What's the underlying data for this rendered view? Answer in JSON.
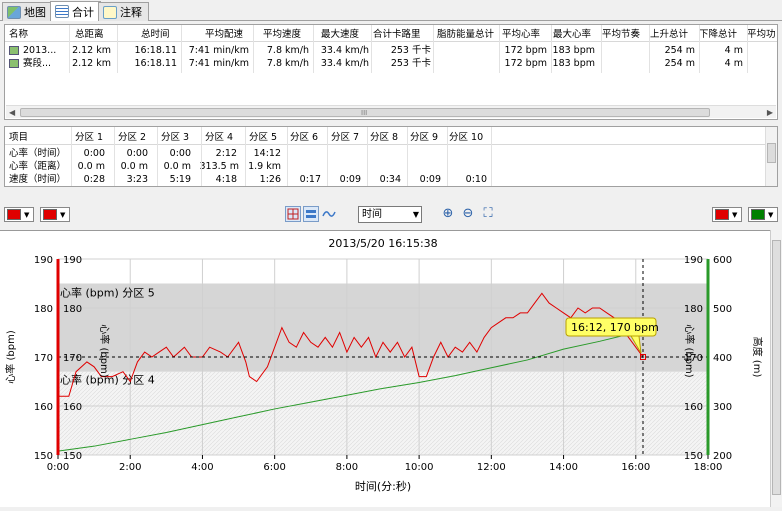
{
  "tabs": [
    {
      "label": "地图",
      "icon": "map-icon"
    },
    {
      "label": "合计",
      "icon": "summary-table-icon"
    },
    {
      "label": "注释",
      "icon": "notes-icon"
    }
  ],
  "summary_table": {
    "columns": [
      "名称",
      "总距离",
      "总时间",
      "平均配速",
      "平均速度",
      "最大速度",
      "合计卡路里",
      "脂肪能量总计",
      "平均心率",
      "最大心率",
      "平均节奏",
      "上升总计",
      "下降总计",
      "平均功"
    ],
    "rows": [
      [
        "2013...",
        "2.12 km",
        "16:18.11",
        "7:41 min/km",
        "7.8 km/h",
        "33.4 km/h",
        "253 千卡",
        "",
        "172 bpm",
        "183 bpm",
        "",
        "254 m",
        "4 m",
        ""
      ],
      [
        "赛段...",
        "2.12 km",
        "16:18.11",
        "7:41 min/km",
        "7.8 km/h",
        "33.4 km/h",
        "253 千卡",
        "",
        "172 bpm",
        "183 bpm",
        "",
        "254 m",
        "4 m",
        ""
      ]
    ],
    "scroll_grip": "III"
  },
  "zone_table": {
    "columns": [
      "项目",
      "分区 1",
      "分区 2",
      "分区 3",
      "分区 4",
      "分区 5",
      "分区 6",
      "分区 7",
      "分区 8",
      "分区 9",
      "分区 10"
    ],
    "rows": [
      [
        "心率（时间）",
        "0:00",
        "0:00",
        "0:00",
        "2:12",
        "14:12",
        "",
        "",
        "",
        "",
        ""
      ],
      [
        "心率（距离）",
        "0.0 m",
        "0.0 m",
        "0.0 m",
        "313.5 m",
        "1.9 km",
        "",
        "",
        "",
        "",
        ""
      ],
      [
        "速度（时间）",
        "0:28",
        "3:23",
        "5:19",
        "4:18",
        "1:26",
        "0:17",
        "0:09",
        "0:34",
        "0:09",
        "0:10"
      ]
    ]
  },
  "toolbar": {
    "x_axis_select": "时间",
    "left_color_1": "#e00000",
    "left_color_2": "#e00000",
    "right_color_1": "#e00000",
    "right_color_2": "#008000"
  },
  "chart_data": {
    "type": "line",
    "title": "2013/5/20 16:15:38",
    "xlabel": "时间(分:秒)",
    "ylabel_left": "心率 (bpm)",
    "ylabel_right": "高度 (m)",
    "ylabel_right_inner": "心率 (bpm)",
    "ylabel_left_inner": "心率 (bpm)",
    "x_ticks": [
      "0:00",
      "2:00",
      "4:00",
      "6:00",
      "8:00",
      "10:00",
      "12:00",
      "14:00",
      "16:00",
      "18:00"
    ],
    "xlim_min": [
      0,
      18
    ],
    "y_left_ticks": [
      150,
      160,
      170,
      180,
      190
    ],
    "ylim_left": [
      150,
      190
    ],
    "y_right_ticks": [
      200,
      300,
      400,
      500,
      600
    ],
    "ylim_right": [
      200,
      600
    ],
    "zones": [
      {
        "label": "心率 (bpm) 分区 5",
        "from": 167,
        "to": 185
      },
      {
        "label": "心率 (bpm) 分区 4",
        "from": 150,
        "to": 167
      }
    ],
    "cursor": {
      "x_min": 16.2,
      "hr": 170,
      "label": "16:12, 170 bpm"
    },
    "series": [
      {
        "name": "心率",
        "axis": "left",
        "color": "#e00000",
        "x_min": [
          0.0,
          0.3,
          0.5,
          0.8,
          1.0,
          1.2,
          1.5,
          1.8,
          2.0,
          2.2,
          2.4,
          2.6,
          2.8,
          3.0,
          3.2,
          3.5,
          3.7,
          4.0,
          4.2,
          4.5,
          4.7,
          5.0,
          5.2,
          5.3,
          5.5,
          5.8,
          6.0,
          6.2,
          6.4,
          6.6,
          6.8,
          7.0,
          7.2,
          7.4,
          7.6,
          7.8,
          8.0,
          8.2,
          8.4,
          8.6,
          8.8,
          9.0,
          9.2,
          9.4,
          9.6,
          9.8,
          10.0,
          10.2,
          10.4,
          10.6,
          10.8,
          11.0,
          11.2,
          11.4,
          11.6,
          11.8,
          12.0,
          12.2,
          12.4,
          12.6,
          12.8,
          13.0,
          13.2,
          13.4,
          13.6,
          13.8,
          14.0,
          14.2,
          14.4,
          14.6,
          14.8,
          15.0,
          15.2,
          15.4,
          15.6,
          15.8,
          16.0,
          16.2
        ],
        "values": [
          162,
          162,
          167,
          169,
          168,
          166,
          166,
          167,
          165,
          169,
          171,
          170,
          171,
          172,
          170,
          172,
          170,
          170,
          172,
          171,
          170,
          173,
          169,
          166,
          165,
          168,
          172,
          176,
          173,
          172,
          175,
          173,
          172,
          174,
          172,
          175,
          171,
          174,
          172,
          174,
          170,
          173,
          171,
          173,
          170,
          172,
          166,
          166,
          170,
          173,
          170,
          172,
          171,
          173,
          171,
          174,
          176,
          177,
          178,
          178,
          179,
          179,
          181,
          183,
          181,
          180,
          179,
          178,
          180,
          179,
          180,
          180,
          179,
          178,
          176,
          174,
          172,
          170
        ]
      },
      {
        "name": "高度",
        "axis": "right",
        "color": "#2a9a2a",
        "x_min": [
          0,
          1,
          2,
          3,
          4,
          5,
          6,
          7,
          8,
          9,
          10,
          11,
          12,
          13,
          14,
          15,
          16,
          16.2
        ],
        "values": [
          208,
          218,
          232,
          246,
          262,
          278,
          294,
          308,
          322,
          336,
          348,
          362,
          378,
          394,
          416,
          432,
          450,
          454
        ]
      }
    ]
  }
}
